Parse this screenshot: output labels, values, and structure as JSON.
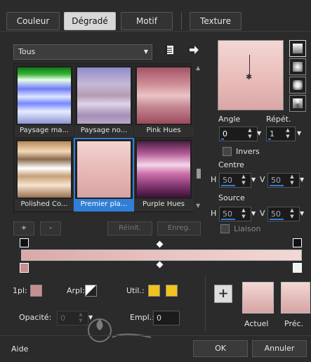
{
  "tabs": [
    {
      "label": "Couleur",
      "active": false
    },
    {
      "label": "Dégradé",
      "active": true
    },
    {
      "label": "Motif",
      "active": false
    },
    {
      "label": "Texture",
      "active": false
    }
  ],
  "gradient_dropdown": {
    "value": "Tous"
  },
  "presets": [
    {
      "label": "Paysage ma...",
      "selected": false
    },
    {
      "label": "Paysage no...",
      "selected": false
    },
    {
      "label": "Pink Hues",
      "selected": false
    },
    {
      "label": "Polished Co...",
      "selected": false
    },
    {
      "label": "Premier pla...",
      "selected": true
    },
    {
      "label": "Purple Hues",
      "selected": false
    }
  ],
  "preset_actions": {
    "add": "+",
    "remove": "-",
    "reset": "Réinit.",
    "save": "Enreg."
  },
  "angle": {
    "label": "Angle",
    "value": "0"
  },
  "repeat": {
    "label": "Répét.",
    "value": "1"
  },
  "invert": {
    "label": "Invers",
    "checked": false
  },
  "center": {
    "label": "Centre",
    "h_label": "H",
    "h_value": "50",
    "v_label": "V",
    "v_value": "50"
  },
  "source": {
    "label": "Source",
    "h_label": "H",
    "h_value": "50",
    "v_label": "V",
    "v_value": "50"
  },
  "link": {
    "label": "Liaison",
    "checked": false
  },
  "bottom": {
    "first_plan_label": "1pl:",
    "arpl_label": "Arpl:",
    "util_label": "Util.:",
    "opacity_label": "Opacité:",
    "opacity_value": "0",
    "empl_label": "Empl.:",
    "empl_value": "0"
  },
  "swatch_labels": {
    "current": "Actuel",
    "previous": "Préc."
  },
  "footer": {
    "help": "Aide",
    "ok": "OK",
    "cancel": "Annuler"
  },
  "colors": {
    "accent": "#2f7fd6",
    "pink_light": "#f2d3d0",
    "pink_dark": "#c78e8f",
    "yellow": "#f2c21d"
  },
  "icons": [
    "palette-icon",
    "arrow-right-icon",
    "plus-icon",
    "star-icon"
  ]
}
